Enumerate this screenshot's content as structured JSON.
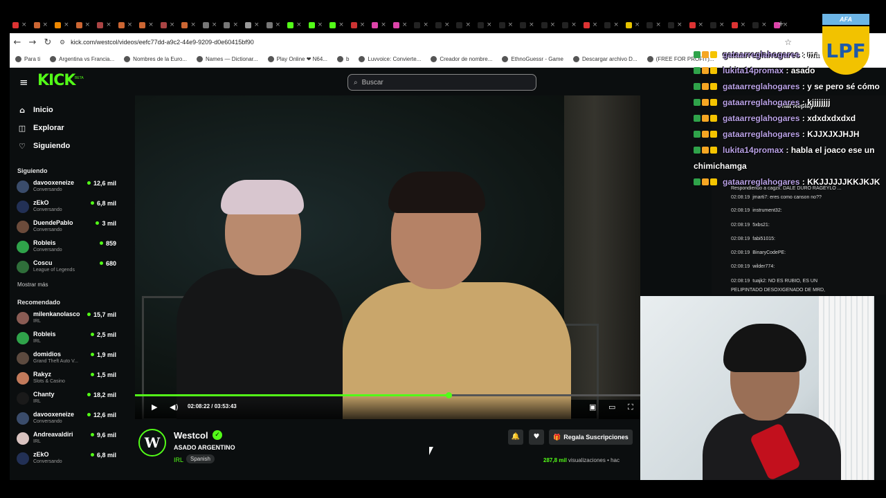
{
  "browser": {
    "url": "kick.com/westcol/videos/eefc77dd-a9c2-44e9-9209-d0e60415bf90",
    "bookmarks": [
      {
        "label": "Para ti"
      },
      {
        "label": "Argentina vs Francia..."
      },
      {
        "label": "Nombres de la Euro..."
      },
      {
        "label": "Names — Dictionar..."
      },
      {
        "label": "Play Online ❤ N64..."
      },
      {
        "label": "b"
      },
      {
        "label": "Luvvoice: Convierte..."
      },
      {
        "label": "Creador de nombre..."
      },
      {
        "label": "EthnoGuessr - Game"
      },
      {
        "label": "Descargar archivo D..."
      },
      {
        "label": "(FREE FOR PROFIT)..."
      }
    ]
  },
  "kick": {
    "logo": "KICK",
    "logo_beta": "BETA",
    "search_placeholder": "Buscar",
    "nav": [
      {
        "label": "Inicio",
        "icon": "home-icon"
      },
      {
        "label": "Explorar",
        "icon": "compass-icon"
      },
      {
        "label": "Siguiendo",
        "icon": "heart-icon"
      }
    ],
    "following_title": "Siguiendo",
    "following": [
      {
        "name": "davooxeneize",
        "category": "Conversando",
        "viewers": "12,6 mil",
        "color": "#3a4c6b"
      },
      {
        "name": "zEkO",
        "category": "Conversando",
        "viewers": "6,8 mil",
        "color": "#223055"
      },
      {
        "name": "DuendePablo",
        "category": "Conversando",
        "viewers": "3 mil",
        "color": "#6b4b3b"
      },
      {
        "name": "Robleis",
        "category": "Conversando",
        "viewers": "859",
        "color": "#2fa34a"
      },
      {
        "name": "Coscu",
        "category": "League of Legends",
        "viewers": "680",
        "color": "#2f6e3a"
      }
    ],
    "show_more": "Mostrar más",
    "recommended_title": "Recomendado",
    "recommended": [
      {
        "name": "milenkanolasco",
        "category": "IRL",
        "viewers": "15,7 mil",
        "color": "#8a5c54"
      },
      {
        "name": "Robleis",
        "category": "IRL",
        "viewers": "2,5 mil",
        "color": "#2fa34a"
      },
      {
        "name": "domidios",
        "category": "Grand Theft Auto V...",
        "viewers": "1,9 mil",
        "color": "#5c4a3f"
      },
      {
        "name": "Rakyz",
        "category": "Slots & Casino",
        "viewers": "1,5 mil",
        "color": "#c27a5b"
      },
      {
        "name": "Chanty",
        "category": "IRL",
        "viewers": "18,2 mil",
        "color": "#1a1a1a"
      },
      {
        "name": "davooxeneize",
        "category": "Conversando",
        "viewers": "12,6 mil",
        "color": "#3a4c6b"
      },
      {
        "name": "Andreavaldiri",
        "category": "IRL",
        "viewers": "9,6 mil",
        "color": "#d9c3c0"
      },
      {
        "name": "zEkO",
        "category": "Conversando",
        "viewers": "6,8 mil",
        "color": "#223055"
      }
    ],
    "player": {
      "time": "02:08:22 / 03:53:43",
      "progress": 0.62
    },
    "channel": {
      "name": "Westcol",
      "avatar_letter": "W",
      "title": "ASADO  ARGENTINO",
      "tag": "IRL",
      "language": "Spanish",
      "gift_label": "Regala Suscripciones",
      "views_count": "287,8 mil",
      "views_label": "visualizaciones",
      "time_ago": "hac"
    },
    "replay": {
      "title": "Chat Replay",
      "messages": [
        {
          "ts": "",
          "text": "Respondiendo a cagzx: DALE DURO RAGEYLO ..."
        },
        {
          "ts": "02:08:19",
          "text": "jmarti7: eres como canson no??"
        },
        {
          "ts": "02:08:19",
          "text": "instrument32:"
        },
        {
          "ts": "02:08:19",
          "text": "5xbs21:"
        },
        {
          "ts": "02:08:19",
          "text": "fabi51015:"
        },
        {
          "ts": "02:08:19",
          "text": "BinaryCodePE:"
        },
        {
          "ts": "02:08:19",
          "text": "wilder774:"
        },
        {
          "ts": "02:08:19",
          "text": "tuajk2: NO ES RUBIO, ES UN"
        },
        {
          "ts": "",
          "text": "PELIPINTADO DESOXIGENADO DE MRD,"
        }
      ]
    }
  },
  "overlay_chat": [
    {
      "user": "gataarreglahogares",
      "text": "ma"
    },
    {
      "user": "lukita14promax",
      "text": "asado"
    },
    {
      "user": "gataarreglahogares",
      "text": "y se pero sé cómo"
    },
    {
      "user": "gataarreglahogares",
      "text": "kjjjjjjjj"
    },
    {
      "user": "gataarreglahogares",
      "text": "xdxdxdxdxd"
    },
    {
      "user": "gataarreglahogares",
      "text": "KJJXJXJHJH"
    },
    {
      "user": "lukita14promax",
      "text": "habla el joaco ese un"
    },
    {
      "user": "",
      "text": "chimichamga"
    },
    {
      "user": "gataarreglahogares",
      "text": "KKJJJJJJKKJKJK"
    }
  ],
  "afa_badge": {
    "top": "AFA",
    "mark": "LPF"
  }
}
